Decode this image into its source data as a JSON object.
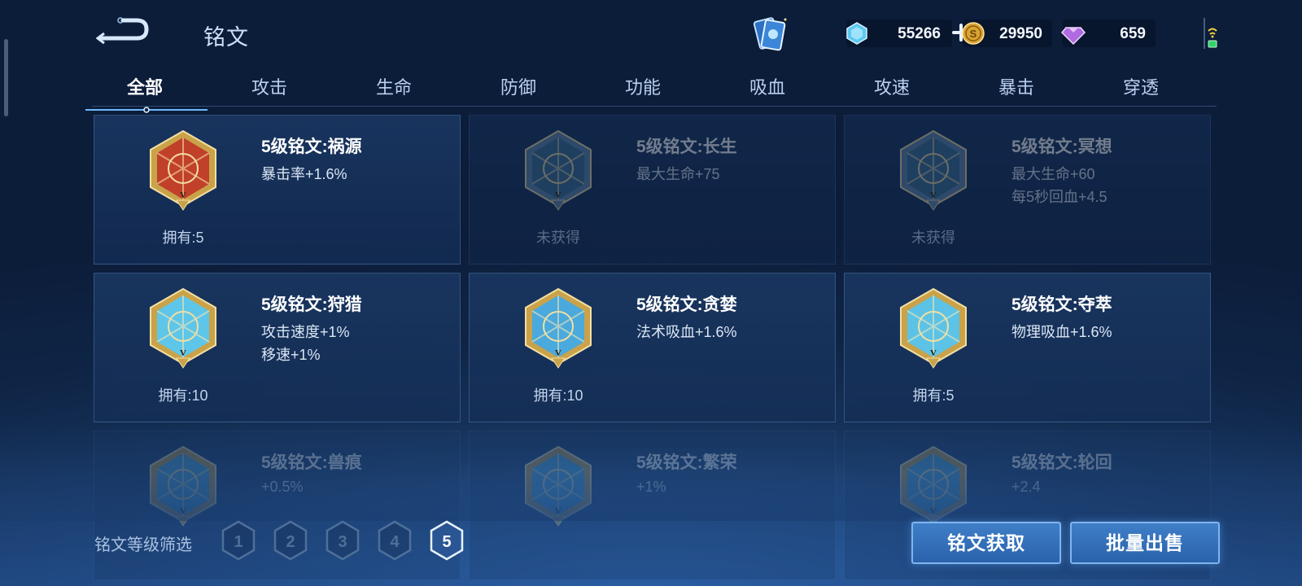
{
  "header": {
    "title": "铭文",
    "currencies": [
      {
        "icon": "crystal-icon",
        "amount": "55266"
      },
      {
        "icon": "gold-coin-icon",
        "amount": "29950"
      },
      {
        "icon": "diamond-icon",
        "amount": "659"
      }
    ]
  },
  "tabs": [
    {
      "label": "全部",
      "active": true
    },
    {
      "label": "攻击"
    },
    {
      "label": "生命"
    },
    {
      "label": "防御"
    },
    {
      "label": "功能"
    },
    {
      "label": "吸血"
    },
    {
      "label": "攻速"
    },
    {
      "label": "暴击"
    },
    {
      "label": "穿透"
    }
  ],
  "cards": [
    {
      "name": "5级铭文:祸源",
      "stats": [
        "暴击率+1.6%"
      ],
      "owned": "拥有:5",
      "state": "owned",
      "color": "#c0402a"
    },
    {
      "name": "5级铭文:长生",
      "stats": [
        "最大生命+75"
      ],
      "owned": "未获得",
      "state": "locked",
      "color": "#3a6f95"
    },
    {
      "name": "5级铭文:冥想",
      "stats": [
        "最大生命+60",
        "每5秒回血+4.5"
      ],
      "owned": "未获得",
      "state": "locked",
      "color": "#3a6f95"
    },
    {
      "name": "5级铭文:狩猎",
      "stats": [
        "攻击速度+1%",
        "移速+1%"
      ],
      "owned": "拥有:10",
      "state": "owned",
      "color": "#5ec6e8"
    },
    {
      "name": "5级铭文:贪婪",
      "stats": [
        "法术吸血+1.6%"
      ],
      "owned": "拥有:10",
      "state": "owned",
      "color": "#4aa9dd"
    },
    {
      "name": "5级铭文:夺萃",
      "stats": [
        "物理吸血+1.6%"
      ],
      "owned": "拥有:5",
      "state": "owned",
      "color": "#5cc3e6"
    },
    {
      "name": "5级铭文:兽痕",
      "stats": [
        "+0.5%"
      ],
      "owned": "",
      "state": "faded",
      "color": "#4aa9dd"
    },
    {
      "name": "5级铭文:繁荣",
      "stats": [
        "+1%"
      ],
      "owned": "",
      "state": "faded",
      "color": "#4aa9dd"
    },
    {
      "name": "5级铭文:轮回",
      "stats": [
        "+2.4"
      ],
      "owned": "",
      "state": "faded",
      "color": "#4aa9dd"
    }
  ],
  "footer": {
    "filter_label": "铭文等级筛选",
    "levels": [
      "1",
      "2",
      "3",
      "4",
      "5"
    ],
    "selected_level": "5",
    "acquire_button": "铭文获取",
    "sell_button": "批量出售"
  }
}
